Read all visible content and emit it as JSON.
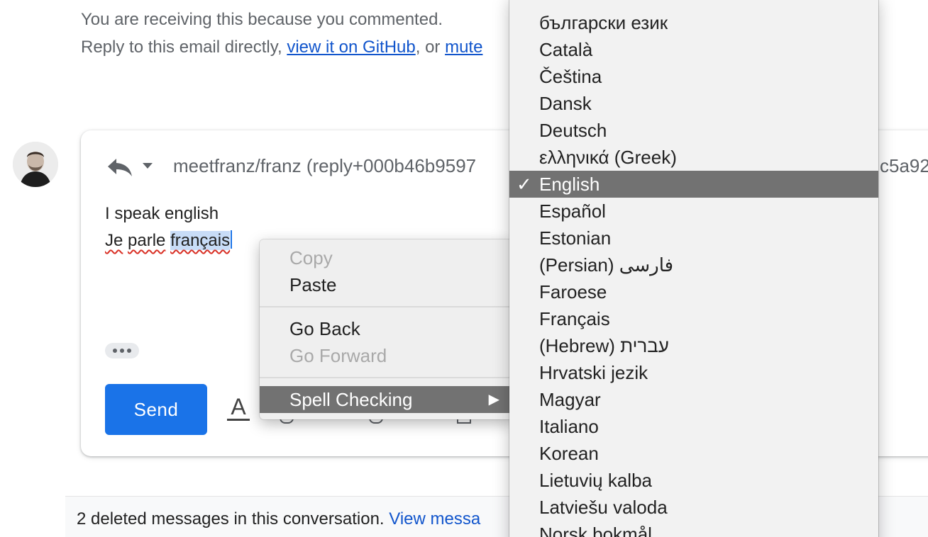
{
  "notice": {
    "line1": "You are receiving this because you commented.",
    "line2_prefix": "Reply to this email directly, ",
    "line2_link1": "view it on GitHub",
    "line2_mid": ", or ",
    "line2_link2": "mute"
  },
  "reply": {
    "recipient": "meetfranz/franz (reply+000b46b9597",
    "recipient_tail": "c5a92",
    "body_line1": "I speak english",
    "body_line2_words": [
      "Je",
      "parle",
      "français"
    ],
    "send_label": "Send",
    "format_icon_glyph": "A"
  },
  "deleted_bar": {
    "text": "2 deleted messages in this conversation. ",
    "link": "View messa"
  },
  "context_menu": {
    "copy": "Copy",
    "paste": "Paste",
    "go_back": "Go Back",
    "go_forward": "Go Forward",
    "spell_checking": "Spell Checking",
    "submenu_arrow": "▶"
  },
  "languages": {
    "check_glyph": "✓",
    "selected": "English",
    "items": [
      "български език",
      "Català",
      "Čeština",
      "Dansk",
      "Deutsch",
      "ελληνικά (Greek)",
      "English",
      "Español",
      "Estonian",
      "(Persian) فارسی",
      "Faroese",
      "Français",
      "(Hebrew) עברית",
      "Hrvatski jezik",
      "Magyar",
      "Italiano",
      "Korean",
      "Lietuvių kalba",
      "Latviešu valoda",
      "Norsk bokmål"
    ]
  },
  "colors": {
    "send_blue": "#1a73e8",
    "link_blue": "#1155cc",
    "menu_highlight": "#727272",
    "spell_underline": "#d93025"
  }
}
